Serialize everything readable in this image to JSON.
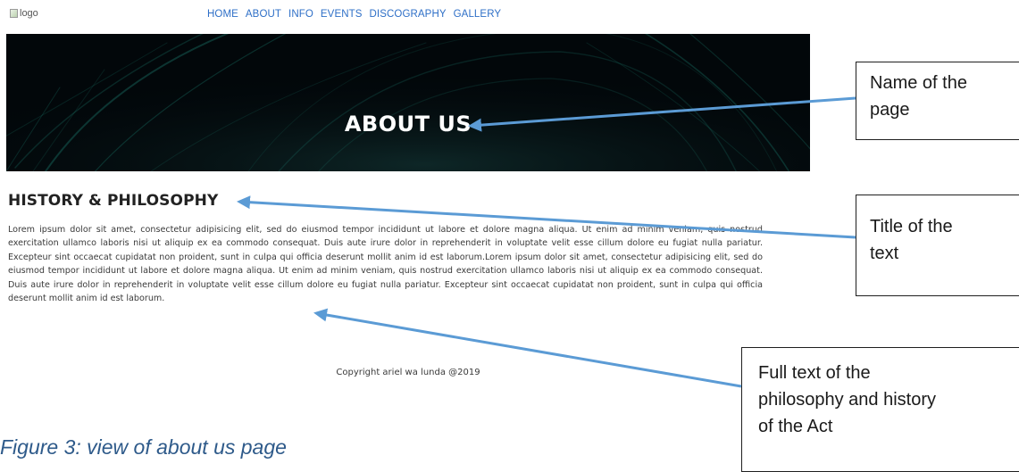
{
  "site": {
    "logo_alt": "logo",
    "nav": [
      "HOME",
      "ABOUT",
      "INFO",
      "EVENTS",
      "DISCOGRAPHY",
      "GALLERY"
    ]
  },
  "banner": {
    "title": "ABOUT US"
  },
  "section": {
    "title": "HISTORY & PHILOSOPHY",
    "body": "Lorem ipsum dolor sit amet, consectetur adipisicing elit, sed do eiusmod tempor incididunt ut labore et dolore magna aliqua. Ut enim ad minim veniam, quis nostrud exercitation ullamco laboris nisi ut aliquip ex ea commodo consequat. Duis aute irure dolor in reprehenderit in voluptate velit esse cillum dolore eu fugiat nulla pariatur. Excepteur sint occaecat cupidatat non proident, sunt in culpa qui officia deserunt mollit anim id est laborum.Lorem ipsum dolor sit amet, consectetur adipisicing elit, sed do eiusmod tempor incididunt ut labore et dolore magna aliqua. Ut enim ad minim veniam, quis nostrud exercitation ullamco laboris nisi ut aliquip ex ea commodo consequat. Duis aute irure dolor in reprehenderit in voluptate velit esse cillum dolore eu fugiat nulla pariatur. Excepteur sint occaecat cupidatat non proident, sunt in culpa qui officia deserunt mollit anim id est laborum."
  },
  "footer": {
    "copyright": "Copyright ariel wa lunda @2019"
  },
  "caption": "Figure 3: view of about us page",
  "callouts": [
    {
      "lines": [
        "Name of the",
        "page"
      ]
    },
    {
      "lines": [
        "Title of the",
        "text"
      ]
    },
    {
      "lines": [
        "Full text of the",
        "philosophy and history",
        "of the Act"
      ]
    }
  ],
  "colors": {
    "nav_link": "#2e6fc7",
    "arrow": "#5b9bd5",
    "caption": "#2e5a8a",
    "banner_bg": "#02070a",
    "banner_streaks": "#1f8a7a"
  }
}
